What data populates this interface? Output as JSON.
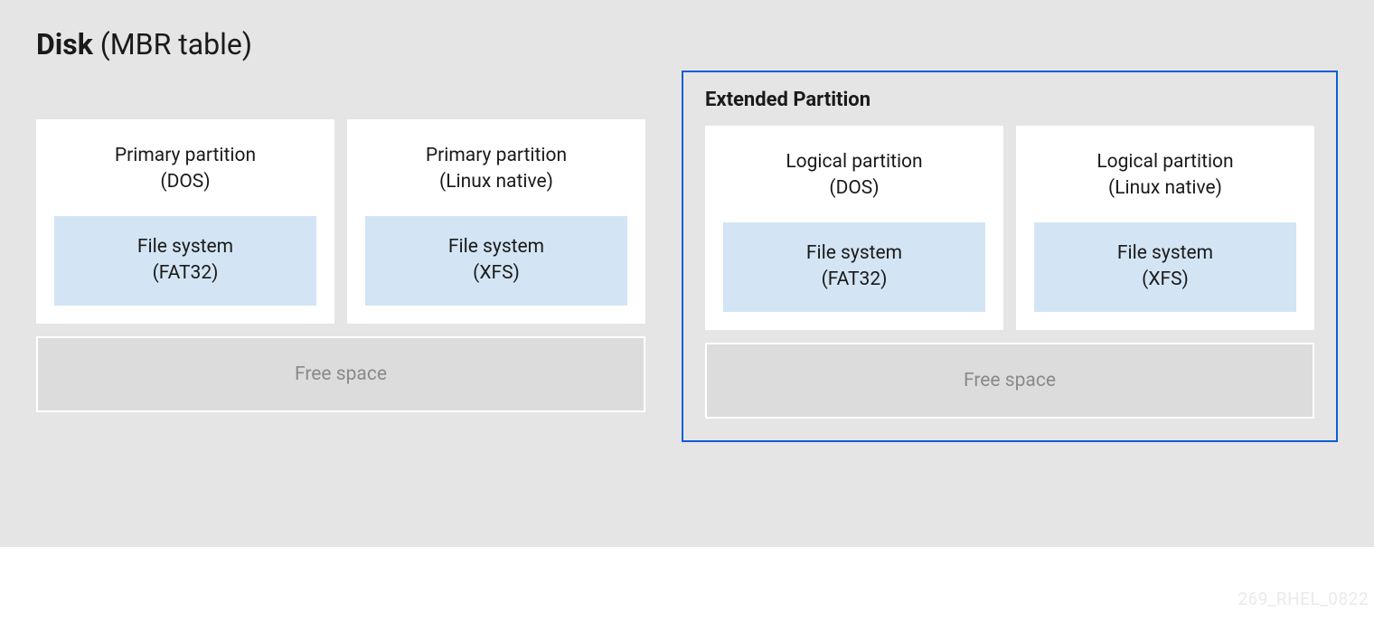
{
  "disk": {
    "title_bold": "Disk",
    "title_rest": " (MBR table)"
  },
  "leftSection": {
    "partitions": [
      {
        "name": "Primary partition",
        "type": "(DOS)",
        "fs_label": "File system",
        "fs_type": "(FAT32)"
      },
      {
        "name": "Primary partition",
        "type": "(Linux native)",
        "fs_label": "File system",
        "fs_type": "(XFS)"
      }
    ],
    "freeSpace": "Free space"
  },
  "rightSection": {
    "title": "Extended Partition",
    "partitions": [
      {
        "name": "Logical partition",
        "type": "(DOS)",
        "fs_label": "File system",
        "fs_type": "(FAT32)"
      },
      {
        "name": "Logical partition",
        "type": "(Linux native)",
        "fs_label": "File system",
        "fs_type": "(XFS)"
      }
    ],
    "freeSpace": "Free space"
  },
  "watermark": "269_RHEL_0822"
}
